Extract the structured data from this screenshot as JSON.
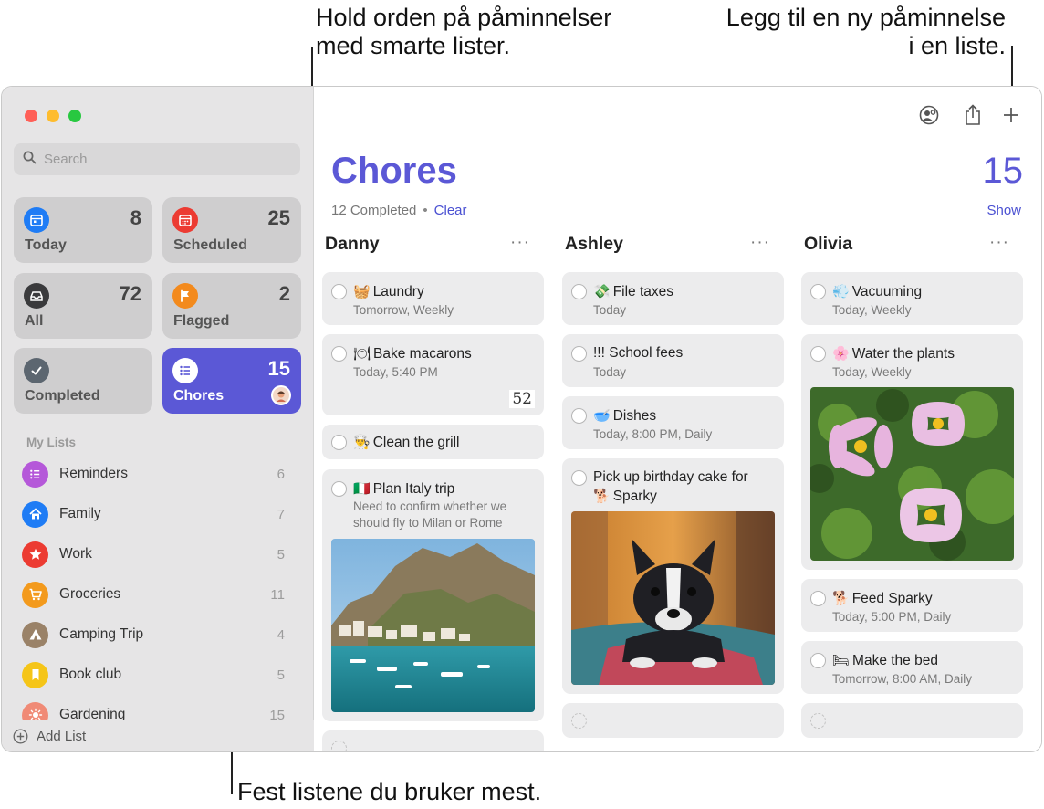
{
  "callouts": {
    "top_left": [
      "Hold orden på påminnelser",
      "med smarte lister."
    ],
    "top_right": [
      "Legg til en ny påminnelse",
      "i en liste."
    ],
    "bottom": "Fest listene du bruker mest."
  },
  "sidebar": {
    "search_placeholder": "Search",
    "smart_lists": [
      {
        "label": "Today",
        "count": "8",
        "icon": "calendar-today-icon",
        "color": "#1f7cf5"
      },
      {
        "label": "Scheduled",
        "count": "25",
        "icon": "calendar-scheduled-icon",
        "color": "#ec3b32"
      },
      {
        "label": "All",
        "count": "72",
        "icon": "tray-icon",
        "color": "#3a3a3c"
      },
      {
        "label": "Flagged",
        "count": "2",
        "icon": "flag-icon",
        "color": "#f38a1d"
      },
      {
        "label": "Completed",
        "count": "",
        "icon": "checkmark-icon",
        "color": "#5c6670"
      },
      {
        "label": "Chores",
        "count": "15",
        "icon": "list-icon",
        "color": "#5b58d6"
      }
    ],
    "section_title": "My Lists",
    "lists": [
      {
        "name": "Reminders",
        "count": "6",
        "icon": "list-icon",
        "color": "#b558d9"
      },
      {
        "name": "Family",
        "count": "7",
        "icon": "house-icon",
        "color": "#1f7cf5"
      },
      {
        "name": "Work",
        "count": "5",
        "icon": "star-icon",
        "color": "#ec3b32"
      },
      {
        "name": "Groceries",
        "count": "11",
        "icon": "cart-icon",
        "color": "#f39a1d"
      },
      {
        "name": "Camping Trip",
        "count": "4",
        "icon": "tent-icon",
        "color": "#9a8268"
      },
      {
        "name": "Book club",
        "count": "5",
        "icon": "bookmark-icon",
        "color": "#f5c518"
      },
      {
        "name": "Gardening",
        "count": "15",
        "icon": "sun-icon",
        "color": "#f08a76"
      }
    ],
    "add_list": "Add List"
  },
  "main": {
    "title": "Chores",
    "count": "15",
    "completed": "12 Completed",
    "separator": "•",
    "clear": "Clear",
    "show": "Show",
    "columns": [
      {
        "name": "Danny",
        "more": "···",
        "cards": [
          {
            "emoji": "🧺",
            "title": "Laundry",
            "subtitle": "Tomorrow, Weekly"
          },
          {
            "emoji": "🍽",
            "title": "Bake macarons",
            "subtitle": "Today, 5:40 PM",
            "badge": "52"
          },
          {
            "emoji": "👨‍🍳",
            "title": "Clean the grill",
            "subtitle": ""
          },
          {
            "emoji": "🇮🇹",
            "title": "Plan Italy trip",
            "subtitle": "Need to confirm whether we should fly to Milan or Rome"
          }
        ]
      },
      {
        "name": "Ashley",
        "more": "···",
        "cards": [
          {
            "emoji": "💸",
            "title": "File taxes",
            "subtitle": "Today"
          },
          {
            "emoji": "",
            "title": "!!! School fees",
            "subtitle": "Today"
          },
          {
            "emoji": "🥣",
            "title": "Dishes",
            "subtitle": "Today, 8:00 PM, Daily"
          },
          {
            "emoji": "🐕",
            "title": "Pick up birthday cake for",
            "title2": "Sparky",
            "subtitle": ""
          }
        ]
      },
      {
        "name": "Olivia",
        "more": "···",
        "cards": [
          {
            "emoji": "💨",
            "title": "Vacuuming",
            "subtitle": "Today, Weekly"
          },
          {
            "emoji": "🌸",
            "title": "Water the plants",
            "subtitle": "Today, Weekly"
          },
          {
            "emoji": "🐕",
            "title": "Feed Sparky",
            "subtitle": "Today, 5:00 PM, Daily"
          },
          {
            "emoji": "🛏",
            "title": "Make the bed",
            "subtitle": "Tomorrow, 8:00 AM, Daily"
          }
        ]
      }
    ]
  }
}
